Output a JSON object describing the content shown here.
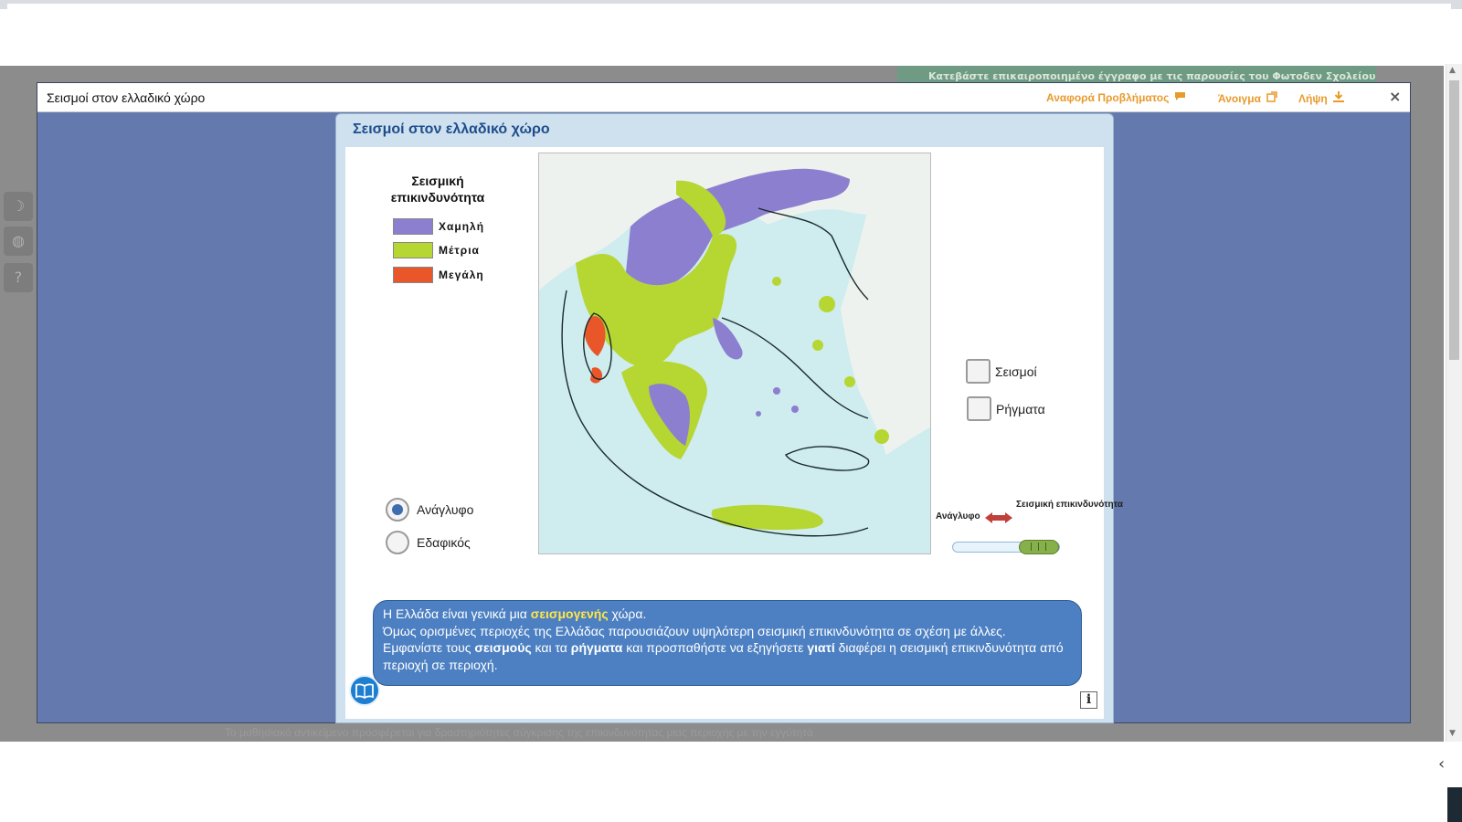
{
  "background": {
    "banner_text": "Κατεβάστε επικαιροποιημένο έγγραφο με τις παρουσίες του Φωτοδεν Σχολείου",
    "footer_text": "Το μαθησιακό αντικείμενο προσφέρεται για δραστηριότητες σύγκρισης της επικινδυνότητας μιας περιοχής με την εγγύτητά"
  },
  "overlay": {
    "title": "Σεισμοί στον ελλαδικό χώρο",
    "report_label": "Αναφορά Προβλήματος",
    "open_label": "Άνοιγμα",
    "download_label": "Λήψη",
    "close_glyph": "×"
  },
  "app": {
    "title": "Σεισμοί στον ελλαδικό χώρο",
    "legend": {
      "title": "Σεισμική επικινδυνότητα",
      "items": [
        {
          "label": "Χαμηλή",
          "color": "#8c7fd0"
        },
        {
          "label": "Μέτρια",
          "color": "#b6d632"
        },
        {
          "label": "Μεγάλη",
          "color": "#e8562a"
        }
      ]
    },
    "map_colors": {
      "sea": "#cfecef",
      "land": "#eef2ef",
      "low": "#8c7fd0",
      "medium": "#b6d632",
      "high": "#e8562a",
      "zone_line": "#1a2a2a"
    },
    "map_mode": {
      "options": [
        "Ανάγλυφο",
        "Εδαφικός"
      ],
      "selected": "Ανάγλυφο"
    },
    "layers": {
      "earthquakes_label": "Σεισμοί",
      "faults_label": "Ρήγματα"
    },
    "slider": {
      "left_label": "Ανάγλυφο",
      "right_label": "Σεισμική επικινδυνότητα",
      "handle_glyph": "| | |",
      "value": 1.0
    },
    "info_text": {
      "line1_pre": "Η Ελλάδα είναι γενικά μια ",
      "line1_hl": "σεισμογενής",
      "line1_post": " χώρα.",
      "line2": "Όμως ορισμένες περιοχές της Ελλάδας παρουσιάζουν υψηλότερη σεισμική επικινδυνότητα σε σχέση με άλλες.",
      "line3_a": "Εμφανίστε τους ",
      "line3_b": "σεισμούς",
      "line3_c": " και τα ",
      "line3_d": "ρήγματα",
      "line3_e": " και προσπαθήστε να εξηγήσετε ",
      "line3_f": "γιατί",
      "line3_g": " διαφέρει η σεισμική επικινδυνότητα από περιοχή σε περιοχή."
    },
    "info_button": "i"
  }
}
